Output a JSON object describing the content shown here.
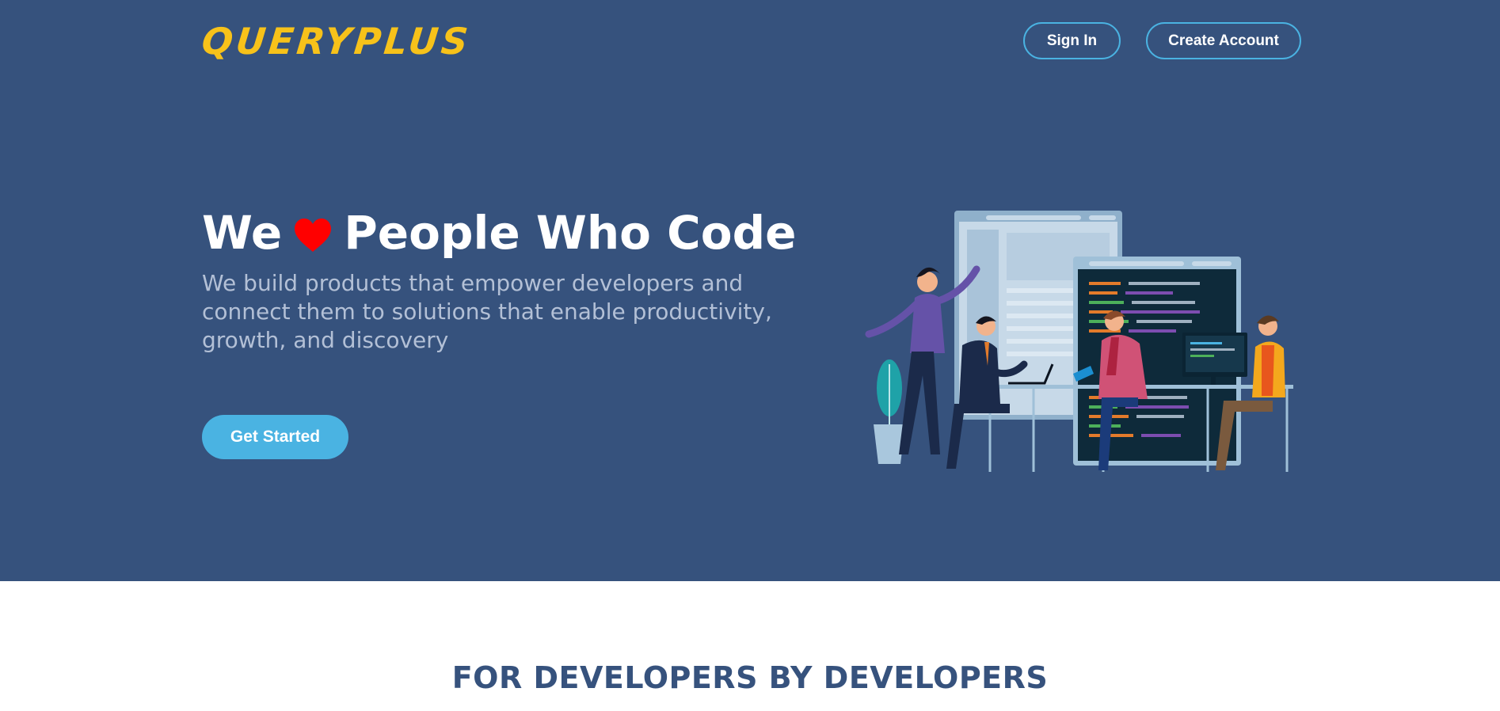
{
  "header": {
    "logo_text": "QUERYPLUS",
    "sign_in_label": "Sign In",
    "create_account_label": "Create Account"
  },
  "hero": {
    "headline_prefix": "We",
    "headline_icon": "heart-icon",
    "headline_suffix": "People Who Code",
    "subtext": "We build products that empower developers and connect them to solutions that enable productivity, growth, and discovery",
    "cta_label": "Get Started",
    "illustration": "developers-team-illustration"
  },
  "section": {
    "title": "FOR DEVELOPERS BY DEVELOPERS"
  },
  "colors": {
    "hero_background": "#36527d",
    "logo": "#f7c21a",
    "accent": "#4ab3e2",
    "heart": "#ff0000",
    "subtext": "#b3c0d6",
    "section_title": "#36527d"
  }
}
